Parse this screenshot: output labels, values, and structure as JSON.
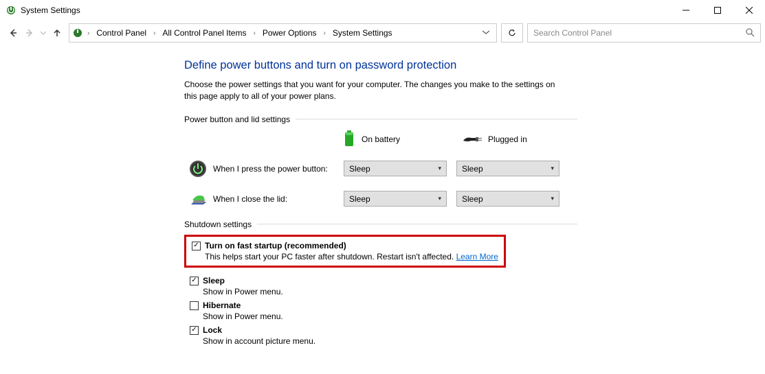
{
  "window": {
    "title": "System Settings"
  },
  "breadcrumbs": {
    "b0": "Control Panel",
    "b1": "All Control Panel Items",
    "b2": "Power Options",
    "b3": "System Settings"
  },
  "search": {
    "placeholder": "Search Control Panel"
  },
  "page": {
    "heading": "Define power buttons and turn on password protection",
    "subtext": "Choose the power settings that you want for your computer. The changes you make to the settings on this page apply to all of your power plans."
  },
  "section1": {
    "title": "Power button and lid settings",
    "col_battery": "On battery",
    "col_plugged": "Plugged in",
    "row_power_btn": "When I press the power button:",
    "row_lid": "When I close the lid:",
    "power_btn_battery": "Sleep",
    "power_btn_plugged": "Sleep",
    "lid_battery": "Sleep",
    "lid_plugged": "Sleep"
  },
  "section2": {
    "title": "Shutdown settings",
    "items": [
      {
        "label": "Turn on fast startup (recommended)",
        "desc": "This helps start your PC faster after shutdown. Restart isn't affected. ",
        "link": "Learn More",
        "checked": true
      },
      {
        "label": "Sleep",
        "desc": "Show in Power menu.",
        "checked": true
      },
      {
        "label": "Hibernate",
        "desc": "Show in Power menu.",
        "checked": false
      },
      {
        "label": "Lock",
        "desc": "Show in account picture menu.",
        "checked": true
      }
    ]
  }
}
